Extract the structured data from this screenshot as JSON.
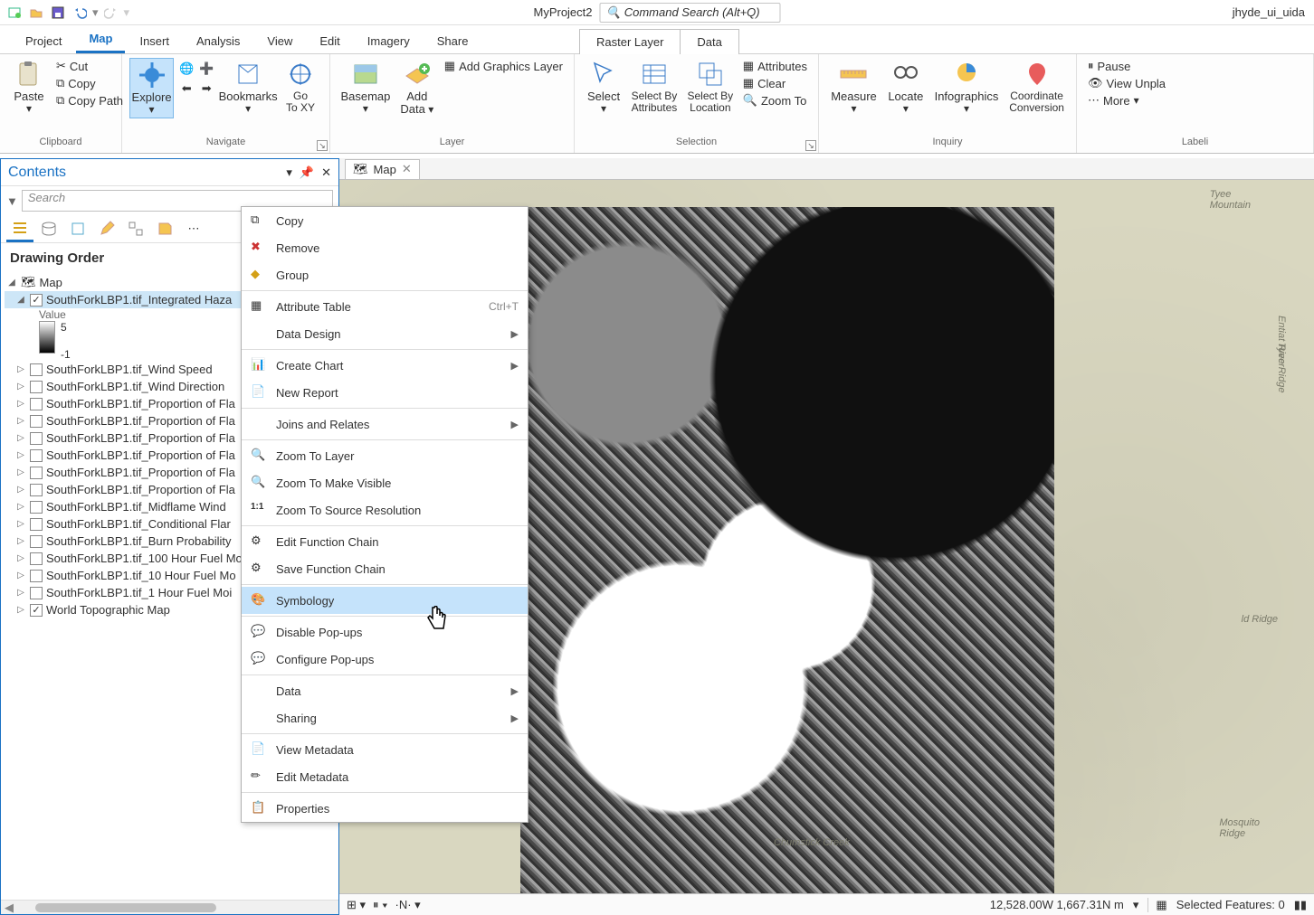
{
  "title_bar": {
    "project_name": "MyProject2",
    "command_search_placeholder": "Command Search (Alt+Q)",
    "user": "jhyde_ui_uida"
  },
  "main_tabs": [
    "Project",
    "Map",
    "Insert",
    "Analysis",
    "View",
    "Edit",
    "Imagery",
    "Share"
  ],
  "active_main_tab": "Map",
  "context_tabs": [
    "Raster Layer",
    "Data"
  ],
  "ribbon": {
    "clipboard": {
      "label": "Clipboard",
      "paste": "Paste",
      "cut": "Cut",
      "copy": "Copy",
      "copy_path": "Copy Path"
    },
    "navigate": {
      "label": "Navigate",
      "explore": "Explore",
      "bookmarks": "Bookmarks",
      "goto": "Go\nTo XY"
    },
    "layer": {
      "label": "Layer",
      "basemap": "Basemap",
      "add_data": "Add\nData",
      "add_graphics": "Add Graphics Layer"
    },
    "selection": {
      "label": "Selection",
      "select": "Select",
      "by_attr": "Select By\nAttributes",
      "by_loc": "Select By\nLocation",
      "attributes": "Attributes",
      "clear": "Clear",
      "zoom_to": "Zoom To"
    },
    "inquiry": {
      "label": "Inquiry",
      "measure": "Measure",
      "locate": "Locate",
      "infographics": "Infographics",
      "coord": "Coordinate\nConversion"
    },
    "labeling": {
      "label": "Labeli",
      "pause": "Pause",
      "view_unpla": "View Unpla",
      "more": "More"
    }
  },
  "contents": {
    "title": "Contents",
    "search_placeholder": "Search",
    "drawing_order": "Drawing Order",
    "map_node": "Map",
    "selected_layer": "SouthForkLBP1.tif_Integrated Haza",
    "value_label": "Value",
    "ramp_top": "5",
    "ramp_bottom": "-1",
    "layers": [
      "SouthForkLBP1.tif_Wind Speed",
      "SouthForkLBP1.tif_Wind Direction",
      "SouthForkLBP1.tif_Proportion of Fla",
      "SouthForkLBP1.tif_Proportion of Fla",
      "SouthForkLBP1.tif_Proportion of Fla",
      "SouthForkLBP1.tif_Proportion of Fla",
      "SouthForkLBP1.tif_Proportion of Fla",
      "SouthForkLBP1.tif_Proportion of Fla",
      "SouthForkLBP1.tif_Midflame Wind",
      "SouthForkLBP1.tif_Conditional Flar",
      "SouthForkLBP1.tif_Burn Probability",
      "SouthForkLBP1.tif_100 Hour Fuel Mo",
      "SouthForkLBP1.tif_10 Hour Fuel Mo",
      "SouthForkLBP1.tif_1 Hour Fuel Moi"
    ],
    "basemap_layer": "World Topographic Map"
  },
  "map_tab": "Map",
  "map_labels": {
    "tyee_mtn": "Tyee\nMountain",
    "tyee_ridge": "Tyee Ridge",
    "ld_ridge": "ld Ridge",
    "mosquito": "Mosquito\nRidge",
    "chumstick": "Chumstick Creek",
    "entiat": "Entiat River"
  },
  "status": {
    "coords": "12,528.00W 1,667.31N m",
    "selected_features": "Selected Features: 0"
  },
  "context_menu": {
    "copy": "Copy",
    "remove": "Remove",
    "group": "Group",
    "attribute_table": "Attribute Table",
    "attribute_table_accel": "Ctrl+T",
    "data_design": "Data Design",
    "create_chart": "Create Chart",
    "new_report": "New Report",
    "joins": "Joins and Relates",
    "zoom_layer": "Zoom To Layer",
    "zoom_visible": "Zoom To Make Visible",
    "zoom_source": "Zoom To Source Resolution",
    "edit_chain": "Edit Function Chain",
    "save_chain": "Save Function Chain",
    "symbology": "Symbology",
    "disable_popups": "Disable Pop-ups",
    "configure_popups": "Configure Pop-ups",
    "data": "Data",
    "sharing": "Sharing",
    "view_meta": "View Metadata",
    "edit_meta": "Edit Metadata",
    "properties": "Properties"
  }
}
